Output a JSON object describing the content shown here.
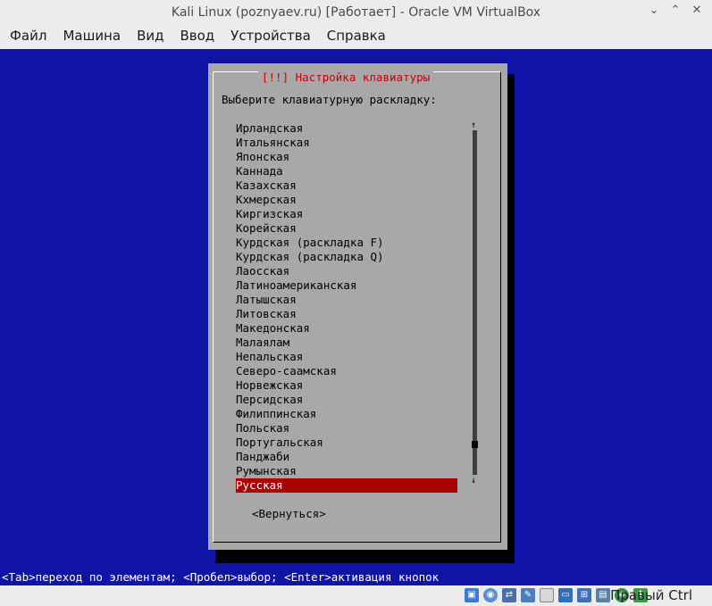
{
  "window": {
    "title": "Kali Linux (poznyaev.ru) [Работает] - Oracle VM VirtualBox",
    "controls": [
      "chevron-down-icon",
      "chevron-up-icon",
      "close-icon"
    ]
  },
  "menu": [
    "Файл",
    "Машина",
    "Вид",
    "Ввод",
    "Устройства",
    "Справка"
  ],
  "dialog": {
    "title": "[!!] Настройка клавиатуры",
    "prompt": "Выберите клавиатурную раскладку:",
    "items": [
      "Ирландская",
      "Итальянская",
      "Японская",
      "Каннада",
      "Казахская",
      "Кхмерская",
      "Киргизская",
      "Корейская",
      "Курдская (раскладка F)",
      "Курдская (раскладка Q)",
      "Лаосская",
      "Латиноамериканская",
      "Латышская",
      "Литовская",
      "Македонская",
      "Малаялам",
      "Непальская",
      "Северо-саамская",
      "Норвежская",
      "Персидская",
      "Филиппинская",
      "Польская",
      "Португальская",
      "Панджаби",
      "Румынская",
      "Русская"
    ],
    "selected_index": 25,
    "scroll_up": "↑",
    "scroll_down": "↓",
    "back_button": "<Вернуться>"
  },
  "status_line": "<Tab>переход по элементам; <Пробел>выбор; <Enter>активация кнопок",
  "statusbar": {
    "host_key": "Правый Ctrl",
    "icons": [
      "hdd-icon",
      "optical-disc-icon",
      "usb-icon",
      "shared-folders-icon",
      "display-icon",
      "pen-icon",
      "screen-icon",
      "network-icon",
      "mouse-integration-icon",
      "capture-icon",
      "record-icon",
      "arrow-down-icon"
    ]
  },
  "colors": {
    "console_bg": "#0f13a6",
    "dialog_bg": "#a8a8a8",
    "selection": "#aa0000",
    "title_text": "#cc0000"
  }
}
